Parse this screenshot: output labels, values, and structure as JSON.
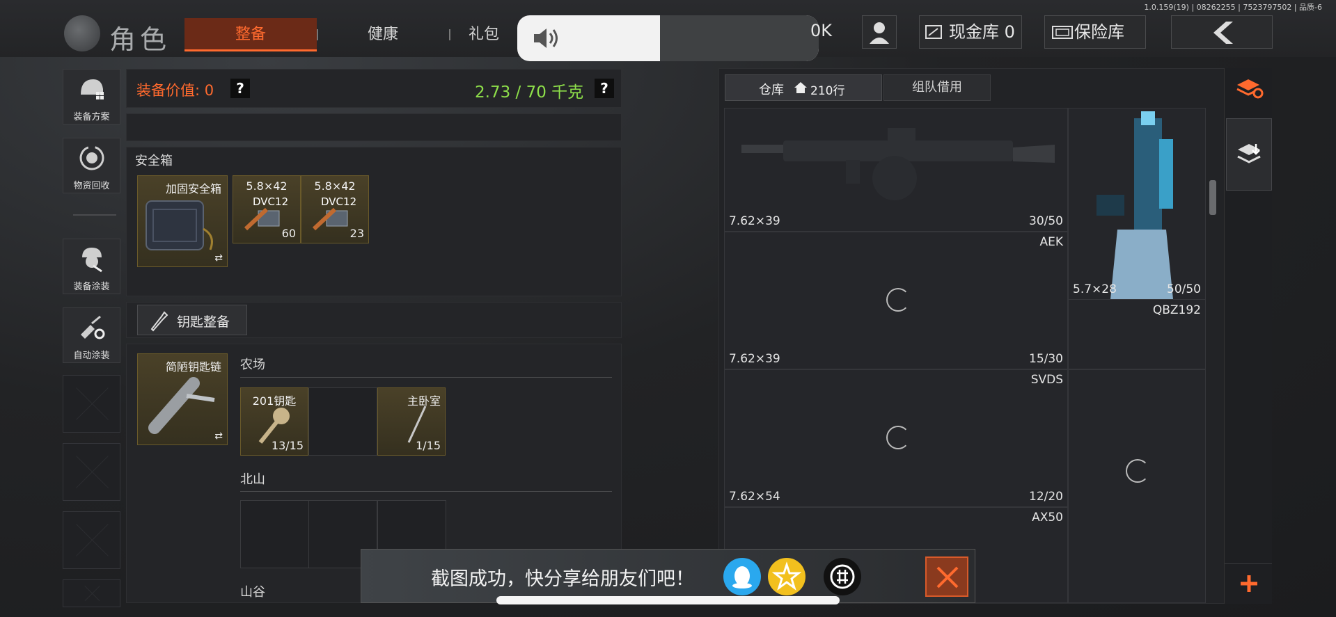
{
  "version": "1.0.159(19) | 08262255 | 7523797502 | 品质-6",
  "header": {
    "title": "角色",
    "tabs": [
      {
        "label": "整备",
        "active": true
      },
      {
        "label": "健康",
        "active": false
      },
      {
        "label": "礼包",
        "active": false
      }
    ],
    "partial_value": "0K",
    "cash_label": "现金库 0",
    "insurance_label": "保险库"
  },
  "sidebar": {
    "items": [
      {
        "label": "装备方案",
        "icon": "helmet-grid-icon"
      },
      {
        "label": "物资回收",
        "icon": "recycle-icon"
      },
      {
        "label": "装备涂装",
        "icon": "soldier-paint-icon"
      },
      {
        "label": "自动涂装",
        "icon": "brush-gear-icon"
      }
    ]
  },
  "equipment": {
    "value_label": "装备价值: 0",
    "weight": "2.73 / 70 千克",
    "help": "?"
  },
  "safebox": {
    "title": "安全箱",
    "box_name": "加固安全箱",
    "items": [
      {
        "caliber": "5.8×42",
        "name": "DVC12",
        "count": "60"
      },
      {
        "caliber": "5.8×42",
        "name": "DVC12",
        "count": "23"
      }
    ]
  },
  "keys": {
    "button_label": "钥匙整备",
    "keychain_name": "简陋钥匙链",
    "sections": [
      {
        "title": "农场",
        "keys": [
          {
            "name": "201钥匙",
            "count": "13/15"
          },
          {
            "name": "主卧室",
            "count": "1/15"
          }
        ]
      },
      {
        "title": "北山",
        "keys": []
      },
      {
        "title": "山谷",
        "keys": []
      }
    ]
  },
  "warehouse": {
    "tab_label": "仓库",
    "rows": "210行",
    "tab2_label": "组队借用",
    "items": [
      {
        "name": "AEK",
        "caliber": "7.62×39",
        "ammo": "30/50"
      },
      {
        "name": "AEK",
        "caliber": "7.62×39",
        "ammo": "15/30"
      },
      {
        "name": "SVDS",
        "caliber": "7.62×54",
        "ammo": "12/20"
      },
      {
        "name": "AX50",
        "caliber": "",
        "ammo": ""
      },
      {
        "name": "QBZ192",
        "caliber": "5.7×28",
        "ammo": "50/50"
      }
    ]
  },
  "toast": {
    "message": "截图成功，快分享给朋友们吧！",
    "share_icons": [
      "qq-icon",
      "qzone-star-icon",
      "wechat-moments-icon"
    ],
    "close": "close-icon"
  },
  "colors": {
    "accent": "#ff6a2e",
    "weight_green": "#8ee04a",
    "slot_gold": "#6a5a2a"
  }
}
